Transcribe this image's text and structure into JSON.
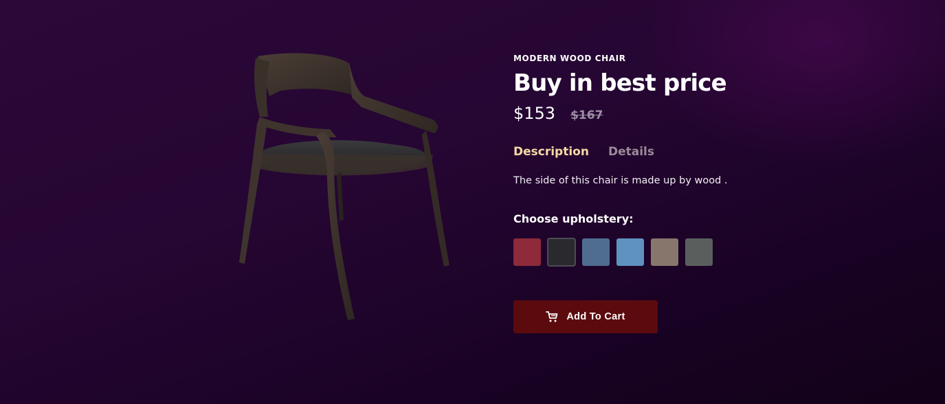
{
  "product": {
    "eyebrow": "MODERN WOOD CHAIR",
    "title": "Buy in best price",
    "price_current": "$153",
    "price_old": "$167",
    "image_alt": "wood-chair"
  },
  "tabs": [
    {
      "label": "Description",
      "active": true
    },
    {
      "label": "Details",
      "active": false
    }
  ],
  "description": "The side of this chair is made up by wood .",
  "upholstery": {
    "heading": "Choose upholstery:",
    "options": [
      {
        "name": "red",
        "color": "#8e2a39",
        "selected": false
      },
      {
        "name": "black",
        "color": "#2a2a2e",
        "selected": true
      },
      {
        "name": "blue-denim",
        "color": "#4f6e8f",
        "selected": false
      },
      {
        "name": "light-blue",
        "color": "#5f92bf",
        "selected": false
      },
      {
        "name": "taupe",
        "color": "#87766b",
        "selected": false
      },
      {
        "name": "grey",
        "color": "#5a5f5e",
        "selected": false
      }
    ]
  },
  "cart": {
    "label": "Add To Cart",
    "icon": "cart-icon"
  },
  "colors": {
    "accent_tab": "#f6d9a4",
    "button_bg": "#5b0b0e"
  }
}
